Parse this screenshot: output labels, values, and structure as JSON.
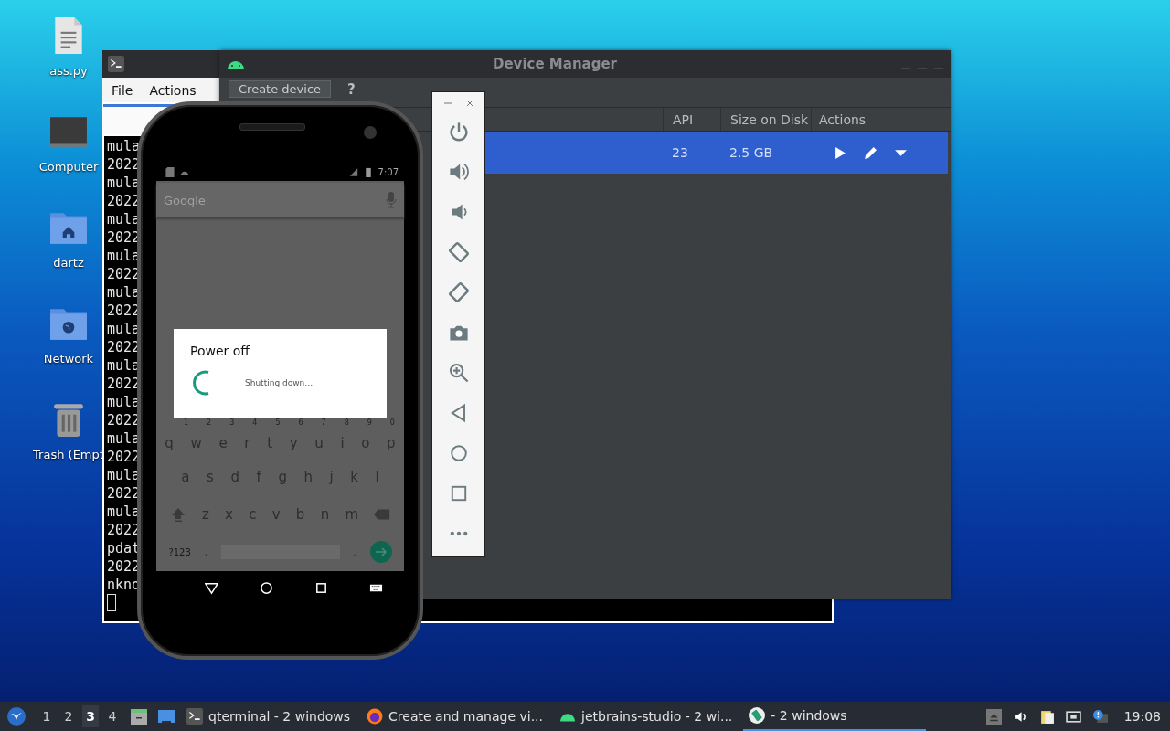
{
  "desktop_icons": [
    {
      "label": "ass.py",
      "kind": "file"
    },
    {
      "label": "Computer",
      "kind": "computer"
    },
    {
      "label": "dartz",
      "kind": "home"
    },
    {
      "label": "Network",
      "kind": "network"
    },
    {
      "label": "Trash (Empt",
      "kind": "trash"
    }
  ],
  "terminal": {
    "menu": [
      "File",
      "Actions"
    ],
    "lines": [
      "mula",
      "2022",
      "mula",
      "2022",
      "mula",
      "2022",
      "mula",
      "2022",
      "mula",
      "2022",
      "mula",
      "2022",
      "mula",
      "2022",
      "mula",
      "2022",
      "mula",
      "2022",
      "mula",
      "2022",
      "mula",
      "2022",
      "pdat",
      "2022",
      "nkno"
    ]
  },
  "device_manager": {
    "title": "Device Manager",
    "create_button": "Create device",
    "help_button": "?",
    "columns": [
      "API",
      "Size on Disk",
      "Actions"
    ],
    "rows": [
      {
        "api": "23",
        "size": "2.5 GB",
        "selected": true
      }
    ]
  },
  "phone": {
    "time": "7:07",
    "search_placeholder": "Google",
    "dialog": {
      "title": "Power off",
      "message": "Shutting down…"
    },
    "number_hints": [
      "1",
      "2",
      "3",
      "4",
      "5",
      "6",
      "7",
      "8",
      "9",
      "0"
    ],
    "key_rows": [
      [
        "q",
        "w",
        "e",
        "r",
        "t",
        "y",
        "u",
        "i",
        "o",
        "p"
      ],
      [
        "a",
        "s",
        "d",
        "f",
        "g",
        "h",
        "j",
        "k",
        "l"
      ],
      [
        "z",
        "x",
        "c",
        "v",
        "b",
        "n",
        "m"
      ]
    ],
    "symbols_key": "?123",
    "comma_key": ",",
    "period_key": "."
  },
  "taskbar": {
    "workspaces": [
      {
        "label": "1",
        "selected": false
      },
      {
        "label": "2",
        "selected": false
      },
      {
        "label": "3",
        "selected": true
      },
      {
        "label": "4",
        "selected": false
      }
    ],
    "tasks": [
      {
        "label": "qterminal - 2 windows",
        "selected": false
      },
      {
        "label": "Create and manage vi...",
        "selected": false
      },
      {
        "label": "jetbrains-studio - 2 wi...",
        "selected": false
      },
      {
        "label": "- 2 windows",
        "selected": true
      }
    ],
    "clock": "19:08"
  }
}
